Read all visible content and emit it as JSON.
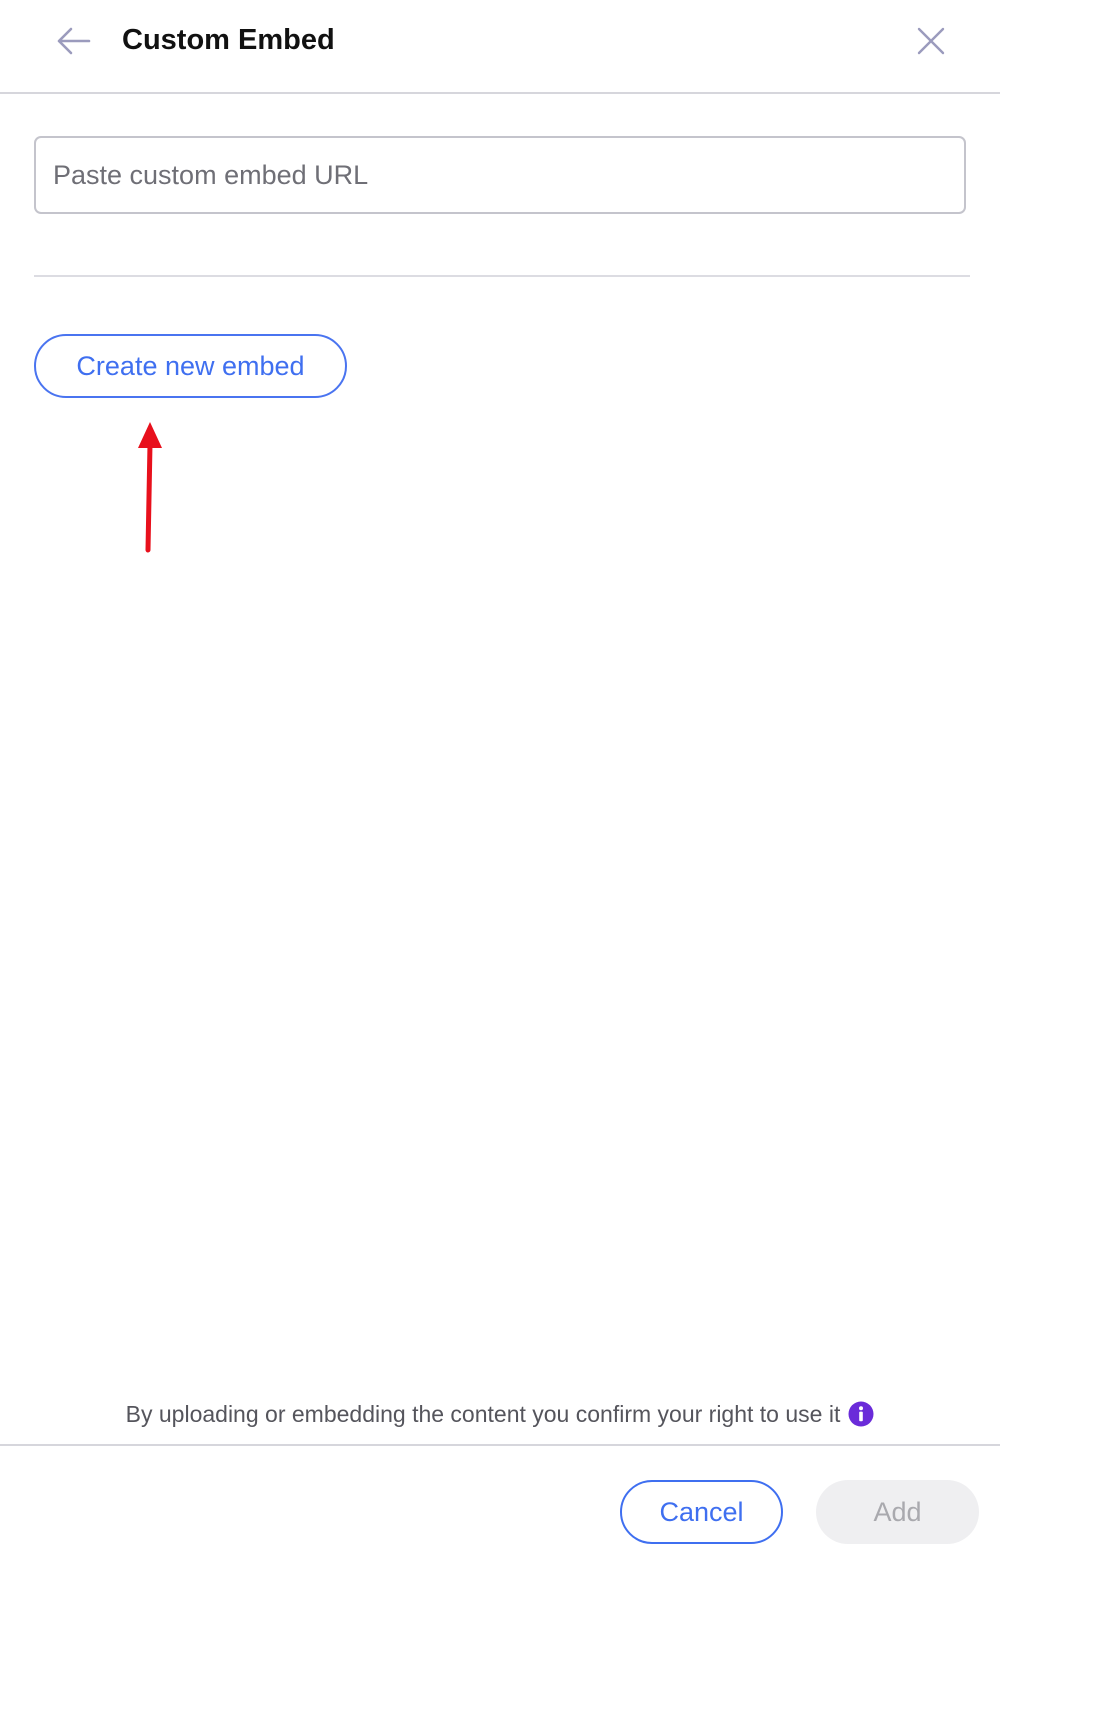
{
  "header": {
    "title": "Custom Embed",
    "back_icon": "arrow-left-icon",
    "close_icon": "close-icon"
  },
  "url_input": {
    "value": "",
    "placeholder": "Paste custom embed URL"
  },
  "create_button": {
    "label": "Create new embed"
  },
  "annotation": {
    "icon": "red-arrow-up-icon",
    "color": "#e8101c"
  },
  "disclaimer": {
    "text": "By uploading or embedding the content you confirm your right to use it",
    "icon": "info-icon",
    "icon_color": "#6a2bd9"
  },
  "footer": {
    "cancel_label": "Cancel",
    "add_label": "Add"
  },
  "colors": {
    "accent": "#3f6ff0",
    "disabled_bg": "#efeff1",
    "disabled_text": "#a9a9ae"
  }
}
